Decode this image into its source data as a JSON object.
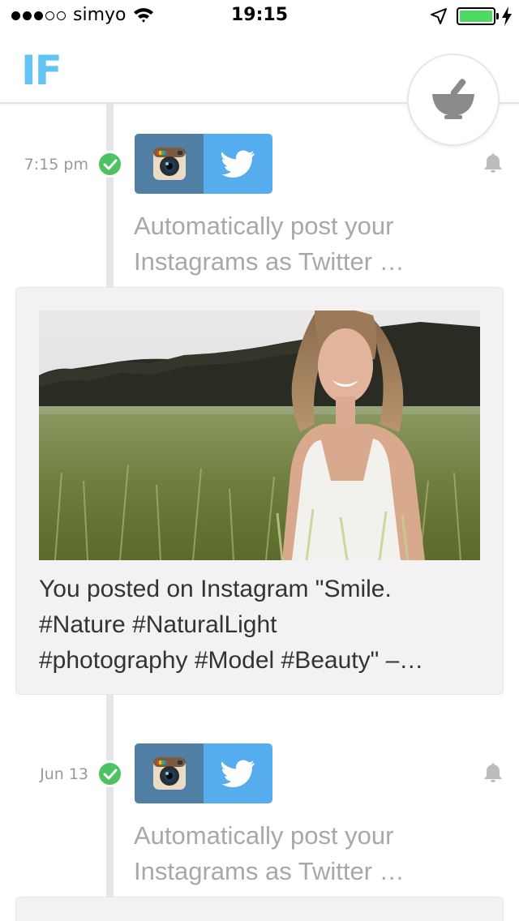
{
  "status_bar": {
    "carrier": "simyo",
    "time": "19:15",
    "signal_dots_filled": 3,
    "signal_dots_total": 5,
    "battery_level": 1.0
  },
  "header": {
    "logo": "IF",
    "fab_icon": "mortar-pestle-icon"
  },
  "colors": {
    "brand": "#61c4f5",
    "check": "#4cc262",
    "instagram": "#517fa4",
    "twitter": "#55acee"
  },
  "timeline": [
    {
      "time": "7:15 pm",
      "applet_icons": [
        "instagram-icon",
        "twitter-icon"
      ],
      "description_line1": "Automatically post your",
      "description_line2": "Instagrams as Twitter …",
      "card": {
        "text_line1": "You posted on Instagram \"Smile.",
        "text_line2": "#Nature #NaturalLight",
        "text_line3": "#photography #Model #Beauty\" –…"
      }
    },
    {
      "time": "Jun 13",
      "applet_icons": [
        "instagram-icon",
        "twitter-icon"
      ],
      "description_line1": "Automatically post your",
      "description_line2": "Instagrams as Twitter …"
    }
  ]
}
